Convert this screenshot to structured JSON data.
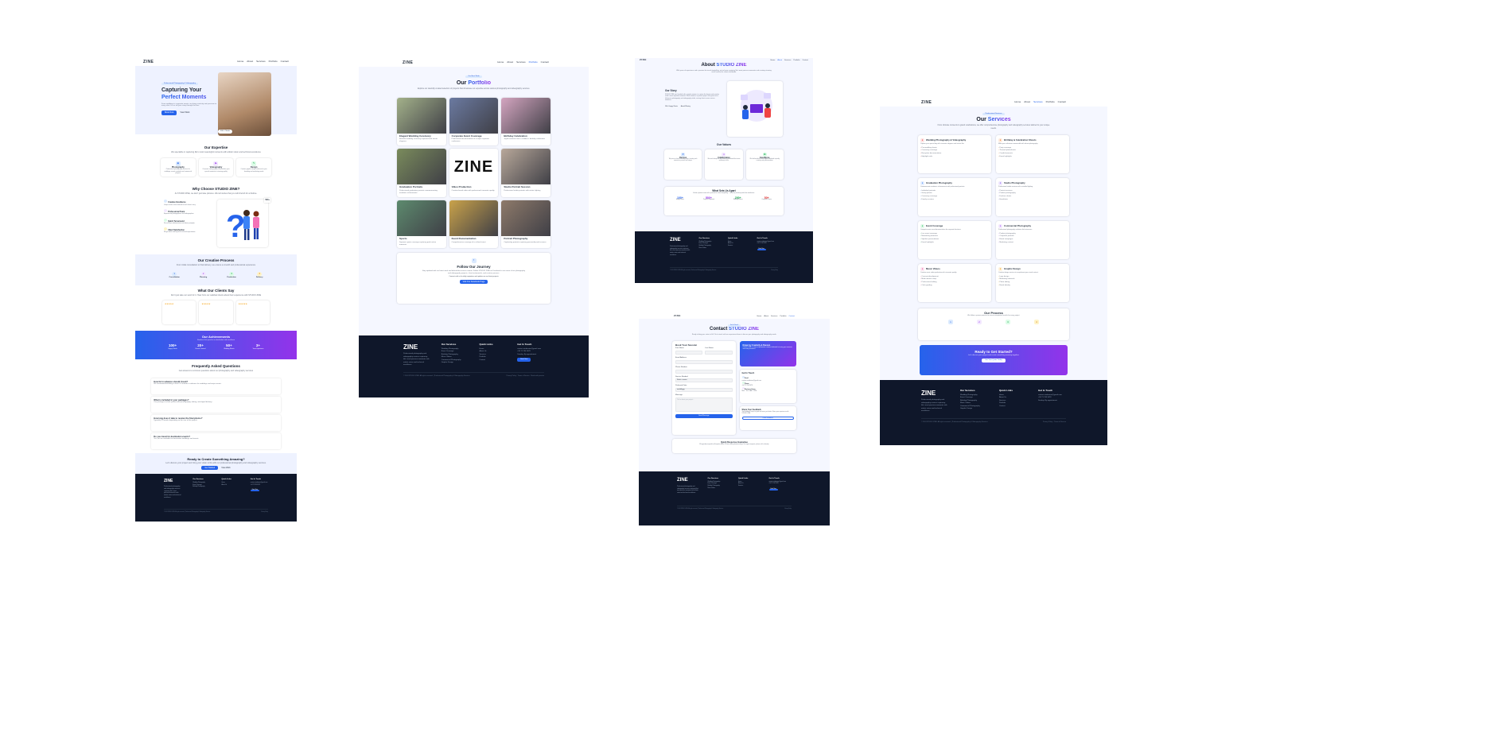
{
  "brand": "ZINE",
  "home": {
    "nav": [
      "Home",
      "About",
      "Services",
      "Portfolio",
      "Contact"
    ],
    "hero": {
      "badge": "Professional Photography & Videography",
      "title_1": "Capturing Your",
      "title_2": "Perfect Moments",
      "desc": "From weddings to corporate events, we bring creativity and precision to every shot. Let us tell your story through the lens.",
      "cta_primary": "Book Now",
      "cta_secondary": "View Work",
      "happy": "500+ Clients"
    },
    "expertise": {
      "title": "Our Expertise",
      "sub": "We specialize in capturing life's most meaningful moments with artistic vision and technical excellence",
      "items": [
        {
          "name": "Photography",
          "desc": "Professional photography services for weddings, events, portraits and commercial projects"
        },
        {
          "name": "Videography",
          "desc": "Cinematic videography to immortalize your special moments in stunning quality"
        },
        {
          "name": "Design",
          "desc": "Creative graphic design solutions for your branding and marketing needs"
        }
      ]
    },
    "why": {
      "title": "Why Choose STUDIO ZINE?",
      "sub": "At STUDIO ZINE, we don't just take pictures. We tell stories that you will cherish for a lifetime.",
      "items": [
        {
          "t": "Creative Excellence",
          "d": "Unique artistic vision tailored to each client's story."
        },
        {
          "t": "Professional Team",
          "d": "Experienced photographers and videographers."
        },
        {
          "t": "Quick Turnaround",
          "d": "Receive your edited photos and videos promptly."
        },
        {
          "t": "Client Satisfaction",
          "d": "We go above and beyond to exceed expectations."
        }
      ],
      "stat": "500+"
    },
    "process": {
      "title": "Our Creative Process",
      "sub": "From initial consultation to final delivery, we ensure a smooth and professional experience",
      "steps": [
        {
          "n": "1",
          "t": "Consultation"
        },
        {
          "n": "2",
          "t": "Planning"
        },
        {
          "n": "3",
          "t": "Production"
        },
        {
          "n": "4",
          "t": "Delivery"
        }
      ]
    },
    "testimonials": {
      "title": "What Our Clients Say",
      "sub": "Don't just take our word for it. Hear from our satisfied clients about their experience with STUDIO ZINE",
      "stars": "★★★★★"
    },
    "achievements": {
      "title": "Our Achievements",
      "sub": "Numbers that speak to our dedication and excellence",
      "items": [
        {
          "v": "100+",
          "l": "Happy Clients"
        },
        {
          "v": "20+",
          "l": "Events Covered"
        },
        {
          "v": "50+",
          "l": "Wedding Shoots"
        },
        {
          "v": "3+",
          "l": "Years Experience"
        }
      ]
    },
    "faq": {
      "title": "Frequently Asked Questions",
      "sub": "Get answers to common questions about our photography and videography services",
      "items": [
        {
          "q": "How far in advance should I book?",
          "a": "We recommend booking at least 2-3 months in advance for weddings and major events."
        },
        {
          "q": "What is included in your packages?",
          "a": "Our packages include professional photography, editing, and digital delivery."
        },
        {
          "q": "How long does it take to receive the final photos?",
          "a": "Typically 2-4 weeks depending on the size of the project."
        },
        {
          "q": "Do you travel for destination events?",
          "a": "Yes, we are available for destination weddings and events."
        }
      ]
    },
    "cta": {
      "title": "Ready to Create Something Amazing?",
      "sub": "Let's discuss your project and bring your vision to life with our professional photography and videography services.",
      "b1": "Get Started",
      "b2": "View Work"
    }
  },
  "portfolio": {
    "nav": [
      "Home",
      "About",
      "Services",
      "Portfolio",
      "Contact"
    ],
    "badge": "Our Best Work",
    "title_1": "Our",
    "title_2": "Portfolio",
    "sub": "Explore our carefully curated selection of projects that showcase our expertise across various photography and videography services.",
    "items": [
      {
        "t": "Elegant Wedding Ceremony",
        "d": "Beautiful wedding ceremony captured with artistic elegance",
        "c": "#a3b18a"
      },
      {
        "t": "Corporate Event Coverage",
        "d": "Professional documentation of a major corporate conference",
        "c": "#6b7aa1"
      },
      {
        "t": "Birthday Celebration",
        "d": "Joyful moments from a children's birthday celebration",
        "c": "#d4a5c0"
      },
      {
        "t": "Graduation Portraits",
        "d": "Professional graduation portraits commemorating academic achievement",
        "c": "#7a8b5c"
      },
      {
        "t": "Video Production",
        "d": "Creative brand video with professional cinematic quality",
        "c": "#ffffff"
      },
      {
        "t": "Studio Portrait Session",
        "d": "Professional studio portraits with artistic lighting",
        "c": "#b8a89a"
      },
      {
        "t": "Sports",
        "d": "Dynamic sports coverage capturing peak action moments",
        "c": "#5d8a6e"
      },
      {
        "t": "Event Documentation",
        "d": "Comprehensive coverage of a cultural event",
        "c": "#c9a24a"
      },
      {
        "t": "Portrait Photography",
        "d": "Captivating portraits capturing personality and essence",
        "c": "#8e7a6a"
      }
    ],
    "video_word": "ZINE",
    "follow": {
      "title": "Follow Our Journey",
      "sub": "Stay updated with our latest work and behind-the-scenes content. Follow STUDIO ZINE on Facebook to see more of our photography and videography projects, client testimonials, and creative process.",
      "note": "Connect with us for daily inspiration and updates on our latest projects",
      "btn": "Visit Our Facebook Page"
    }
  },
  "about": {
    "nav": [
      "Home",
      "About",
      "Services",
      "Portfolio",
      "Contact"
    ],
    "title_1": "About",
    "title_2": "STUDIO ZINE",
    "sub": "With years of experience and a passion for visual storytelling, we've been capturing life's most precious moments and creating stunning visual content for clients worldwide.",
    "story_title": "Our Story",
    "story": "STUDIO ZINE was founded with a simple mission: to capture the beauty and emotion of life's most important moments. What started as a passion project has grown into a full-service photography and videography studio, serving clients across various industries.",
    "tags": [
      "500+ Happy Clients",
      "Award Winning"
    ],
    "values_title": "Our Values",
    "values": [
      {
        "t": "Passion",
        "d": "We pour our heart into every project, treating each moment as precious and unique."
      },
      {
        "t": "Collaboration",
        "d": "We work closely with our clients to understand their vision and bring it to life."
      },
      {
        "t": "Excellence",
        "d": "We hold ourselves to the highest standards in quality, creativity and professionalism."
      }
    ],
    "apart_title": "What Sets Us Apart",
    "apart_sub": "A fresh, dynamic team with a passion for visual storytelling — driven by creativity and client satisfaction.",
    "apart": [
      {
        "v": "100+",
        "l": "Happy Clients",
        "c": "#2563eb"
      },
      {
        "v": "500+",
        "l": "Projects Completed",
        "c": "#9333ea"
      },
      {
        "v": "200+",
        "l": "Wedding Events",
        "c": "#16a34a"
      },
      {
        "v": "50+",
        "l": "Corporate Clients",
        "c": "#dc2626"
      }
    ]
  },
  "contact": {
    "nav": [
      "Home",
      "About",
      "Services",
      "Portfolio",
      "Contact"
    ],
    "badge": "Get In Touch",
    "title_1": "Contact",
    "title_2": "STUDIO ZINE",
    "sub": "Ready to bring your vision to life? Get in touch with our experienced team to discuss your photography and videography needs.",
    "form": {
      "title": "Book Your Session",
      "labels": [
        "First Name",
        "Last Name",
        "Email Address",
        "Phone Number",
        "Service Needed",
        "Preferred Date",
        "Message"
      ],
      "service_value": "Select a service",
      "date_value": "mm/dd/yyyy",
      "message_ph": "Tell us about your project...",
      "submit": "Send Message"
    },
    "driven": {
      "t": "Driven by Creativity & Passion",
      "d": "STUDIO ZINE is a team of passionate creatives dedicated to turning your moments into lasting memories."
    },
    "touch": {
      "title": "Get In Touch",
      "items": [
        {
          "l": "Email",
          "v": "contact.studiozine@gmail.com"
        },
        {
          "l": "Phone",
          "v": "+94 71 234 5678"
        },
        {
          "l": "Business Hours",
          "v": "Mon – Sat: 9AM – 6PM"
        }
      ]
    },
    "feedback": {
      "t": "Share Your Feedback",
      "d": "Your feedback helps us grow and serve you better. Share your experience with STUDIO ZINE.",
      "btn": "Leave Feedback"
    },
    "quick": {
      "t": "Quick Response Guarantee",
      "d": "We typically respond to all inquiries within 24 hours during business days. For urgent requests, please call us directly."
    }
  },
  "services": {
    "nav": [
      "Home",
      "About",
      "Services",
      "Portfolio",
      "Contact"
    ],
    "badge": "Professional Services",
    "title_1": "Our",
    "title_2": "Services",
    "sub": "From intimate moments to grand celebrations, we offer comprehensive photography and videography services tailored to your unique needs.",
    "items": [
      {
        "t": "Wedding Photography & Videography",
        "d": "Capture your special day with cinematic elegance and artistic flair.",
        "b": [
          "Pre-wedding shoots",
          "Ceremony coverage",
          "Reception documentation",
          "Highlight reels"
        ],
        "c": "#ef4444"
      },
      {
        "t": "Birthday & Celebration Shoots",
        "d": "Make your milestones memorable with vibrant photography.",
        "b": [
          "Party coverage",
          "Themed photoshoots",
          "Candid moments",
          "Event highlights"
        ],
        "c": "#f97316"
      },
      {
        "t": "Graduation Photography",
        "d": "Commemorate academic achievements with professional portraits.",
        "b": [
          "Individual portraits",
          "Group photos",
          "Ceremony coverage",
          "Family sessions"
        ],
        "c": "#3b82f6"
      },
      {
        "t": "Studio Photography",
        "d": "Professional studio sessions with controlled lighting.",
        "b": [
          "Portrait sessions",
          "Product photography",
          "Fashion shoots",
          "Headshots"
        ],
        "c": "#8b5cf6"
      },
      {
        "t": "Event Coverage",
        "d": "Comprehensive event documentation for corporate functions.",
        "b": [
          "Live event coverage",
          "Networking moments",
          "Speaker presentations",
          "Event highlights"
        ],
        "c": "#22c55e"
      },
      {
        "t": "Commercial Photography",
        "d": "Professional photography solutions for businesses.",
        "b": [
          "Product photography",
          "Corporate portraits",
          "Brand campaigns",
          "Marketing content"
        ],
        "c": "#a855f7"
      },
      {
        "t": "Music Videos",
        "d": "Creative music video production with cinematic quality.",
        "b": [
          "Concept development",
          "Multi-camera setup",
          "Professional editing",
          "Color grading"
        ],
        "c": "#ec4899"
      },
      {
        "t": "Graphic Design",
        "d": "Creative design services to complement your visual content.",
        "b": [
          "Logo design",
          "Marketing materials",
          "Photo editing",
          "Brand identity"
        ],
        "c": "#f59e0b"
      }
    ],
    "process_title": "Our Process",
    "process_sub": "We follow a proven process to ensure exceptional results for every project",
    "process": [
      "1",
      "2",
      "3",
      "4"
    ],
    "cta": {
      "t": "Ready to Get Started?",
      "d": "Let's discuss your project and create something amazing together",
      "btn": "Get Your Quote Today"
    }
  },
  "footer": {
    "desc": "Professional photography and videography services capturing life's most precious moments with artistic vision and technical excellence.",
    "services_title": "Our Services",
    "services": [
      "Wedding Photography",
      "Event Coverage",
      "Birthday Photography",
      "Music Videos",
      "Commercial Photography",
      "Graphic Design"
    ],
    "links_title": "Quick Links",
    "links": [
      "Home",
      "About Us",
      "Services",
      "Portfolio",
      "Contact"
    ],
    "touch_title": "Get In Touch",
    "touch": [
      "contact.studiozine@gmail.com",
      "+94 71 234 5678",
      "Sunday: By appointment"
    ],
    "book": "Book Now",
    "copyright": "© 2024 STUDIO ZINE. All rights reserved. | Professional Photography & Videography Services",
    "legal": [
      "Privacy Policy",
      "Terms of Service",
      "Made with passion"
    ]
  }
}
